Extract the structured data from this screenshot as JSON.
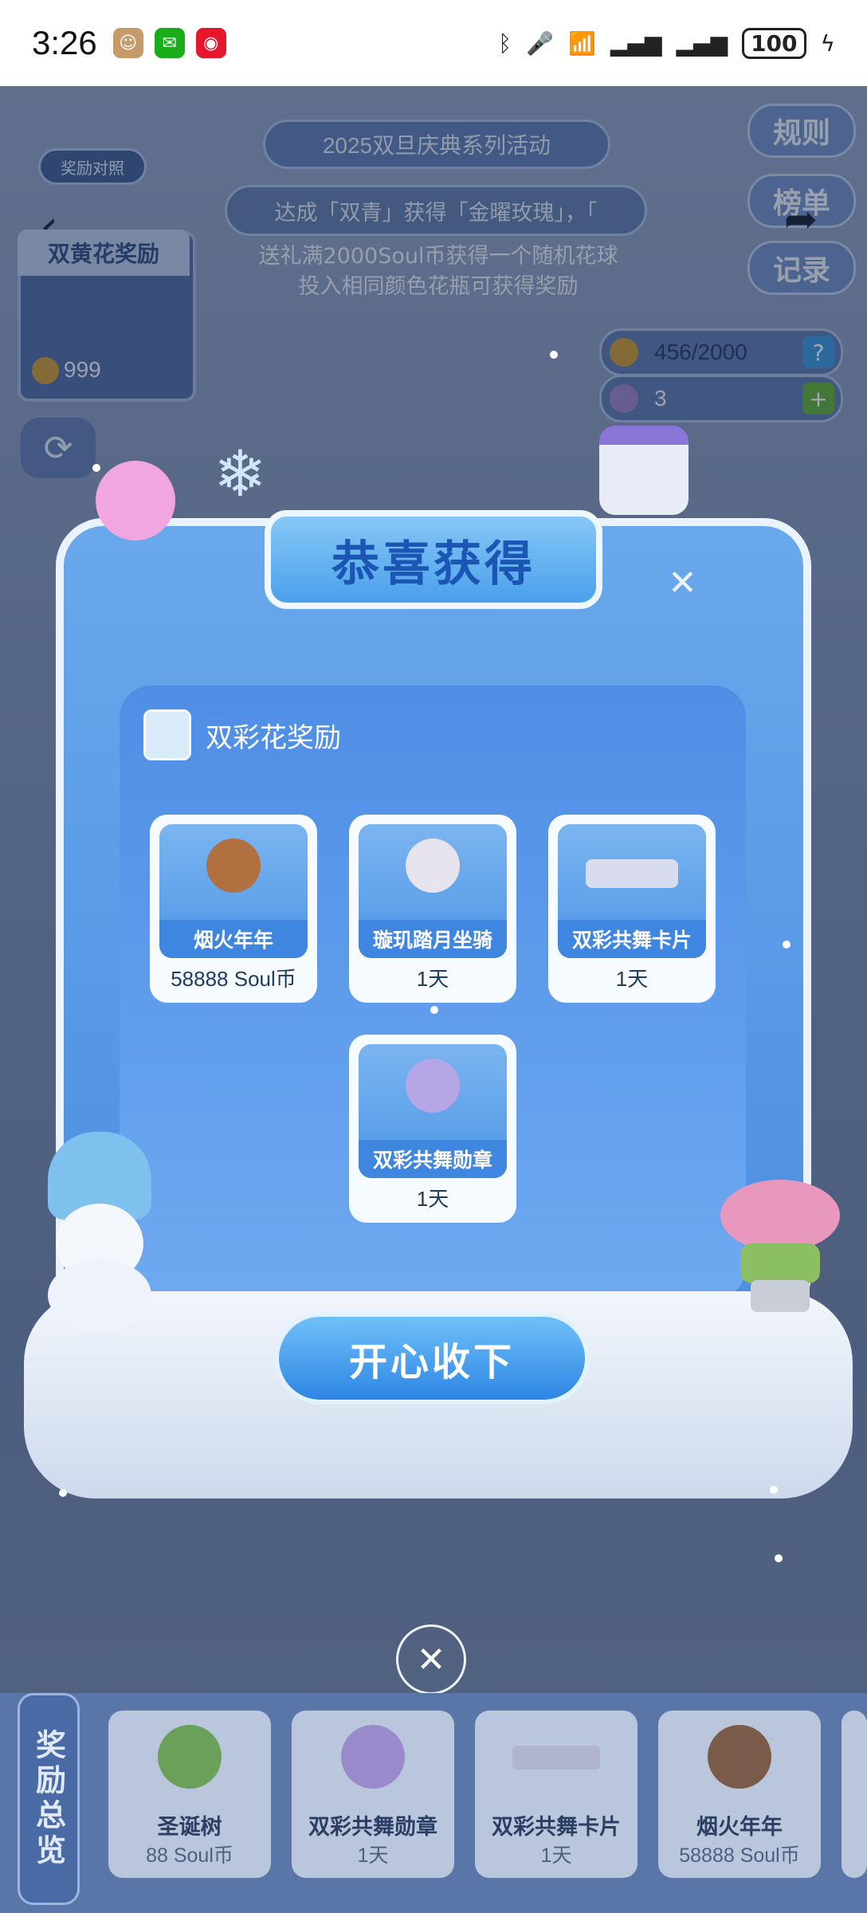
{
  "status_bar": {
    "time": "3:26",
    "apps": [
      {
        "icon": "avatar-app-icon",
        "color": "#c79a6a"
      },
      {
        "icon": "wechat-icon",
        "color": "#1aad19"
      },
      {
        "icon": "weibo-icon",
        "color": "#e6162d"
      }
    ],
    "battery": "100"
  },
  "background": {
    "event_subtitle": "2025双旦庆典系列活动",
    "reward_compare": "奖励对照",
    "marquee": "达成「双青」获得「金曜玫瑰」，「",
    "instruction_line1": "送礼满2000Soul币获得一个随机花球",
    "instruction_line2": "投入相同颜色花瓶可获得奖励",
    "side_buttons": [
      "规则",
      "榜单",
      "记录"
    ],
    "house_title": "双黄花奖励",
    "house_coin": "999",
    "progress_text": "456/2000",
    "flower_count": "3"
  },
  "popup": {
    "title": "恭喜获得",
    "section_title": "双彩花奖励",
    "rewards": [
      {
        "name": "烟火年年",
        "sub": "58888 Soul币",
        "color": "#b07040"
      },
      {
        "name": "璇玑踏月坐骑",
        "sub": "1天",
        "color": "#e8e4ef"
      },
      {
        "name": "双彩共舞卡片",
        "sub": "1天",
        "color": "#d8dcef"
      },
      {
        "name": "双彩共舞勋章",
        "sub": "1天",
        "color": "#b6a6e6"
      }
    ],
    "confirm_button": "开心收下"
  },
  "overview": {
    "label": "奖励总览",
    "items": [
      {
        "name": "圣诞树",
        "sub": "88 Soul币",
        "color": "#6aa05a"
      },
      {
        "name": "双彩共舞勋章",
        "sub": "1天",
        "color": "#9a8acc"
      },
      {
        "name": "双彩共舞卡片",
        "sub": "1天",
        "color": "#b0b4cc"
      },
      {
        "name": "烟火年年",
        "sub": "58888 Soul币",
        "color": "#7a5a48"
      }
    ]
  }
}
